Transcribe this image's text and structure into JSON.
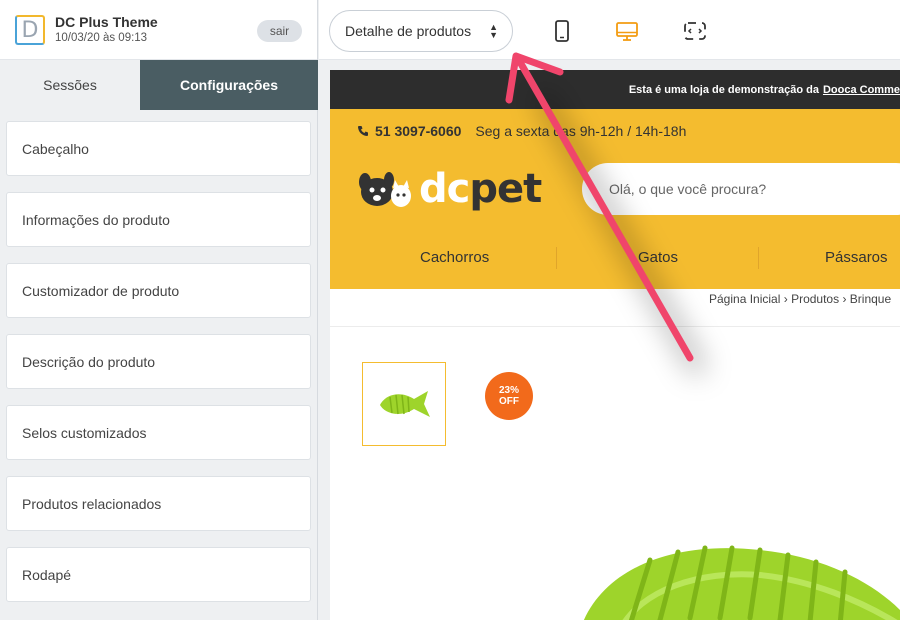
{
  "theme": {
    "name": "DC Plus Theme",
    "date": "10/03/20 às 09:13",
    "logout_label": "sair",
    "logo_letter": "D"
  },
  "tabs": [
    {
      "label": "Sessões",
      "active": false
    },
    {
      "label": "Configurações",
      "active": true
    }
  ],
  "sections": [
    {
      "label": "Cabeçalho"
    },
    {
      "label": "Informações do produto"
    },
    {
      "label": "Customizador de produto"
    },
    {
      "label": "Descrição do produto"
    },
    {
      "label": "Selos customizados"
    },
    {
      "label": "Produtos relacionados"
    },
    {
      "label": "Rodapé"
    }
  ],
  "toolbar": {
    "page_select_value": "Detalhe de produtos",
    "icons": [
      "mobile-icon",
      "desktop-icon",
      "fullscreen-icon"
    ],
    "active_icon": "desktop-icon"
  },
  "store": {
    "demo_text": "Esta é uma loja de demonstração da",
    "demo_link": "Dooca Comme",
    "phone": "51 3097-6060",
    "hours": "Seg a sexta das 9h-12h / 14h-18h",
    "logo_part1": "dc",
    "logo_part2": "pet",
    "search_placeholder": "Olá, o que você procura?",
    "categories": [
      "Cachorros",
      "Gatos",
      "Pássaros"
    ],
    "breadcrumb": [
      "Página Inicial",
      "Produtos",
      "Brinque"
    ],
    "discount_line1": "23%",
    "discount_line2": "OFF"
  },
  "colors": {
    "accent": "#f4bc2f",
    "dark_tab": "#4a5d63",
    "arrow": "#f0456b",
    "badge": "#f26a1b",
    "active_icon": "#f39c12"
  }
}
